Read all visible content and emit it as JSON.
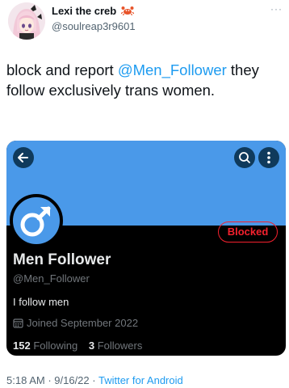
{
  "author": {
    "display_name": "Lexi the creb",
    "emoji_icon": "crab-icon",
    "handle": "@soulreap3r9601"
  },
  "tweet": {
    "text_before": "block and report ",
    "mention": "@Men_Follower",
    "text_after": " they follow exclusively trans women."
  },
  "embedded_profile": {
    "banner_color": "#4a99e9",
    "back_icon": "arrow-left-icon",
    "search_icon": "search-icon",
    "menu_icon": "more-vertical-icon",
    "avatar_icon": "male-symbol-icon",
    "blocked_label": "Blocked",
    "name": "Men Follower",
    "handle": "@Men_Follower",
    "bio": "I follow men",
    "joined": "Joined September 2022",
    "following_count": "152",
    "following_label": "Following",
    "followers_count": "3",
    "followers_label": "Followers"
  },
  "meta": {
    "time": "5:18 AM",
    "separator": " · ",
    "date": "9/16/22",
    "source": "Twitter for Android"
  },
  "colors": {
    "accent": "#1d9bf0",
    "blocked": "#f4212e"
  }
}
